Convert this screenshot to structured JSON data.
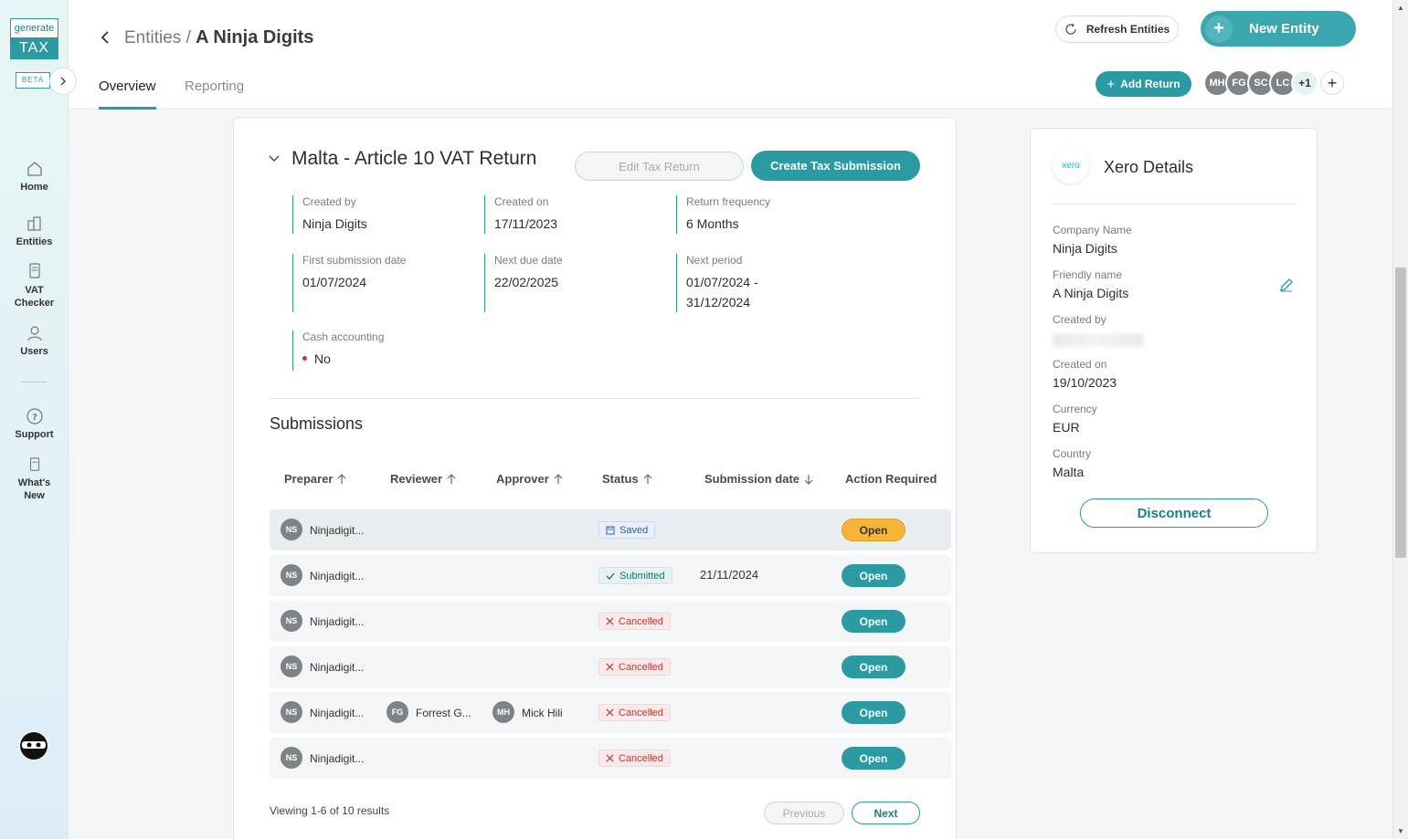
{
  "sidebar": {
    "logo_top": "generate",
    "logo_bottom": "TAX",
    "beta": "BETA",
    "items": [
      {
        "label": "Home"
      },
      {
        "label": "Entities"
      },
      {
        "label": "VAT Checker"
      },
      {
        "label": "Users"
      },
      {
        "label": "Support"
      },
      {
        "label": "What's New"
      }
    ]
  },
  "header": {
    "breadcrumb_parent": "Entities",
    "breadcrumb_sep": " / ",
    "breadcrumb_current": "A Ninja Digits",
    "refresh_label": "Refresh Entities",
    "new_entity_label": "New Entity",
    "tabs": [
      {
        "label": "Overview",
        "active": true
      },
      {
        "label": "Reporting",
        "active": false
      }
    ],
    "add_return_label": "Add Return",
    "avatars": [
      "MH",
      "FG",
      "SC",
      "LC"
    ],
    "more_count": "+1"
  },
  "return": {
    "title": "Malta - Article 10 VAT Return",
    "edit_label": "Edit Tax Return",
    "create_label": "Create Tax Submission",
    "fields": {
      "created_by": {
        "label": "Created by",
        "value": "Ninja Digits"
      },
      "created_on": {
        "label": "Created on",
        "value": "17/11/2023"
      },
      "frequency": {
        "label": "Return frequency",
        "value": "6 Months"
      },
      "first_submission": {
        "label": "First submission date",
        "value": "01/07/2024"
      },
      "next_due": {
        "label": "Next due date",
        "value": "22/02/2025"
      },
      "next_period": {
        "label": "Next period",
        "value_line1": "01/07/2024 -",
        "value_line2": "31/12/2024"
      },
      "cash_accounting": {
        "label": "Cash accounting",
        "value": "No"
      }
    }
  },
  "submissions": {
    "title": "Submissions",
    "columns": [
      "Preparer",
      "Reviewer",
      "Approver",
      "Status",
      "Submission date",
      "Action Required"
    ],
    "rows": [
      {
        "preparer_initials": "NS",
        "preparer": "Ninjadigit...",
        "status": "Saved",
        "date": "",
        "action": "Open"
      },
      {
        "preparer_initials": "NS",
        "preparer": "Ninjadigit...",
        "status": "Submitted",
        "date": "21/11/2024",
        "action": "Open"
      },
      {
        "preparer_initials": "NS",
        "preparer": "Ninjadigit...",
        "status": "Cancelled",
        "date": "",
        "action": "Open"
      },
      {
        "preparer_initials": "NS",
        "preparer": "Ninjadigit...",
        "status": "Cancelled",
        "date": "",
        "action": "Open"
      },
      {
        "preparer_initials": "NS",
        "preparer": "Ninjadigit...",
        "reviewer_initials": "FG",
        "reviewer": "Forrest G...",
        "approver_initials": "MH",
        "approver": "Mick Hili",
        "status": "Cancelled",
        "date": "",
        "action": "Open"
      },
      {
        "preparer_initials": "NS",
        "preparer": "Ninjadigit...",
        "status": "Cancelled",
        "date": "",
        "action": "Open"
      }
    ],
    "viewing": "Viewing 1-6 of 10 results",
    "prev_label": "Previous",
    "next_label": "Next"
  },
  "xero": {
    "logo": "xero",
    "title": "Xero Details",
    "company_name": {
      "label": "Company Name",
      "value": "Ninja Digits"
    },
    "friendly_name": {
      "label": "Friendly name",
      "value": "A Ninja Digits"
    },
    "created_by": {
      "label": "Created by"
    },
    "created_on": {
      "label": "Created on",
      "value": "19/10/2023"
    },
    "currency": {
      "label": "Currency",
      "value": "EUR"
    },
    "country": {
      "label": "Country",
      "value": "Malta"
    },
    "disconnect_label": "Disconnect"
  },
  "colors": {
    "accent": "#2b9aa3",
    "warning": "#f6b537",
    "danger": "#c0392b"
  }
}
